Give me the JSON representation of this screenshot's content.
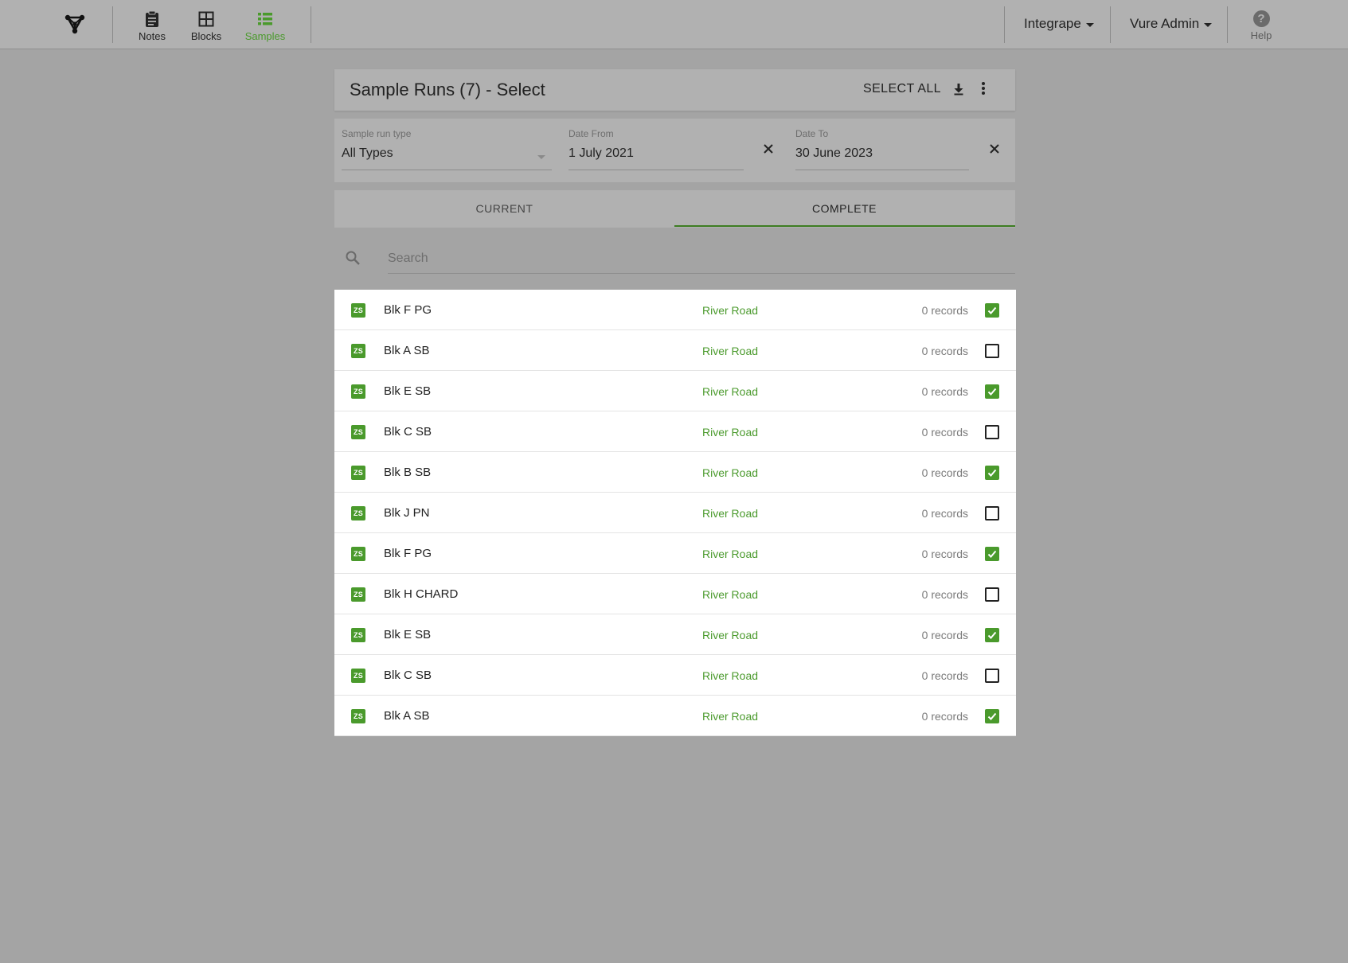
{
  "nav": {
    "items": [
      {
        "label": "Notes",
        "icon": "clipboard-icon",
        "active": false
      },
      {
        "label": "Blocks",
        "icon": "grid-icon",
        "active": false
      },
      {
        "label": "Samples",
        "icon": "list-icon",
        "active": true
      }
    ],
    "org_menu": "Integrape",
    "user_menu": "Vure Admin",
    "help_label": "Help"
  },
  "header": {
    "title": "Sample Runs (7) - Select",
    "select_all_label": "SELECT ALL"
  },
  "filters": {
    "type_label": "Sample run type",
    "type_value": "All Types",
    "date_from_label": "Date From",
    "date_from_value": "1 July 2021",
    "date_to_label": "Date To",
    "date_to_value": "30 June 2023"
  },
  "tabs": [
    {
      "label": "CURRENT",
      "active": false
    },
    {
      "label": "COMPLETE",
      "active": true
    }
  ],
  "search": {
    "placeholder": "Search"
  },
  "colors": {
    "accent": "#4a9a2c"
  },
  "rows": [
    {
      "badge": "ZS",
      "name": "Blk F PG",
      "location": "River Road",
      "records": "0 records",
      "checked": true
    },
    {
      "badge": "ZS",
      "name": "Blk A SB",
      "location": "River Road",
      "records": "0 records",
      "checked": false
    },
    {
      "badge": "ZS",
      "name": "Blk E SB",
      "location": "River Road",
      "records": "0 records",
      "checked": true
    },
    {
      "badge": "ZS",
      "name": "Blk C SB",
      "location": "River Road",
      "records": "0 records",
      "checked": false
    },
    {
      "badge": "ZS",
      "name": "Blk B SB",
      "location": "River Road",
      "records": "0 records",
      "checked": true
    },
    {
      "badge": "ZS",
      "name": "Blk J PN",
      "location": "River Road",
      "records": "0 records",
      "checked": false
    },
    {
      "badge": "ZS",
      "name": "Blk F PG",
      "location": "River Road",
      "records": "0 records",
      "checked": true
    },
    {
      "badge": "ZS",
      "name": "Blk H CHARD",
      "location": "River Road",
      "records": "0 records",
      "checked": false
    },
    {
      "badge": "ZS",
      "name": "Blk E SB",
      "location": "River Road",
      "records": "0 records",
      "checked": true
    },
    {
      "badge": "ZS",
      "name": "Blk C SB",
      "location": "River Road",
      "records": "0 records",
      "checked": false
    },
    {
      "badge": "ZS",
      "name": "Blk A SB",
      "location": "River Road",
      "records": "0 records",
      "checked": true
    }
  ]
}
